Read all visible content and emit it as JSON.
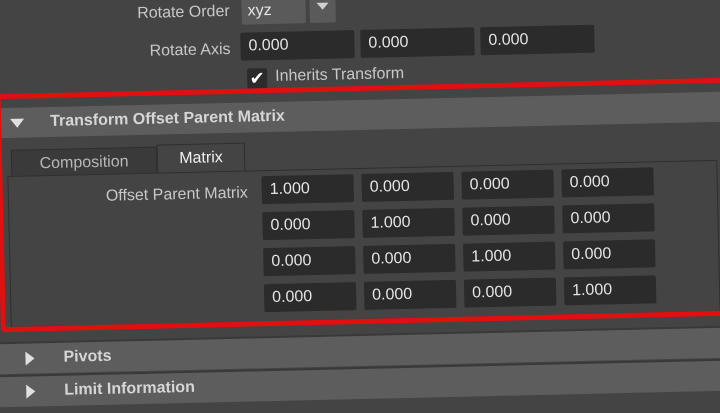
{
  "rotate_order": {
    "label": "Rotate Order",
    "value": "xyz"
  },
  "rotate_axis": {
    "label": "Rotate Axis",
    "values": [
      "0.000",
      "0.000",
      "0.000"
    ]
  },
  "inherits_transform": {
    "label": "Inherits Transform",
    "checked": true,
    "check_glyph": "✔"
  },
  "sections": {
    "transform_offset": {
      "title": "Transform Offset Parent Matrix",
      "expanded": true
    },
    "pivots": {
      "title": "Pivots",
      "expanded": false
    },
    "limit_information": {
      "title": "Limit Information",
      "expanded": false
    }
  },
  "tabs": [
    {
      "label": "Composition",
      "active": false
    },
    {
      "label": "Matrix",
      "active": true
    }
  ],
  "offset_parent_matrix": {
    "label": "Offset Parent Matrix",
    "rows": [
      [
        "1.000",
        "0.000",
        "0.000",
        "0.000"
      ],
      [
        "0.000",
        "1.000",
        "0.000",
        "0.000"
      ],
      [
        "0.000",
        "0.000",
        "1.000",
        "0.000"
      ],
      [
        "0.000",
        "0.000",
        "0.000",
        "1.000"
      ]
    ]
  },
  "colors": {
    "highlight": "#e01010",
    "background": "#444444",
    "field": "#2b2b2b",
    "header": "#5d5d5d"
  }
}
